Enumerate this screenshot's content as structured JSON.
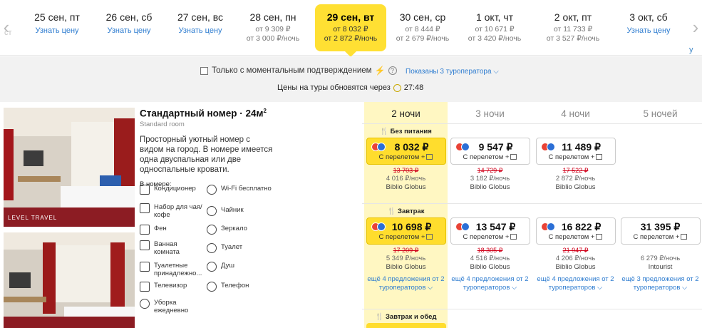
{
  "nav": {
    "prev_ghost": "ст\nу",
    "next_ghost": "у"
  },
  "dates": [
    {
      "day": "25 сен, пт",
      "link": "Узнать цену"
    },
    {
      "day": "26 сен, сб",
      "link": "Узнать цену"
    },
    {
      "day": "27 сен, вс",
      "link": "Узнать цену"
    },
    {
      "day": "28 сен, пн",
      "price_total": "от 9 309 ₽",
      "price_night": "от 3 000 ₽/ночь"
    },
    {
      "day": "29 сен, вт",
      "price_total": "от 8 032 ₽",
      "price_night": "от 2 872 ₽/ночь",
      "selected": true
    },
    {
      "day": "30 сен, ср",
      "price_total": "от 8 444 ₽",
      "price_night": "от 2 679 ₽/ночь"
    },
    {
      "day": "1 окт, чт",
      "price_total": "от 10 671 ₽",
      "price_night": "от 3 420 ₽/ночь"
    },
    {
      "day": "2 окт, пт",
      "price_total": "от 11 733 ₽",
      "price_night": "от 3 527 ₽/ночь"
    },
    {
      "day": "3 окт, сб",
      "link": "Узнать цену"
    }
  ],
  "filters": {
    "instant_label": "Только с моментальным подтверждением",
    "operators_label": "Показаны 3 туроператора",
    "update_label": "Цены на туры обновятся через",
    "update_timer": "27:48"
  },
  "room": {
    "title": "Стандартный номер · 24м",
    "title_sup": "2",
    "subtitle": "Standard room",
    "description": "Просторный уютный номер с видом на город. В номере имеется одна двуспальная или две односпальные кровати.",
    "amenities_heading": "В номере:",
    "watermark": "LEVEL TRAVEL",
    "amenities": [
      {
        "icon": "air-conditioner-icon",
        "label": "Кондиционер"
      },
      {
        "icon": "wifi-icon",
        "label": "Wi-Fi бесплатно"
      },
      {
        "icon": "tea-set-icon",
        "label": "Набор для чая/ кофе"
      },
      {
        "icon": "kettle-icon",
        "label": "Чайник"
      },
      {
        "icon": "hairdryer-icon",
        "label": "Фен"
      },
      {
        "icon": "mirror-icon",
        "label": "Зеркало"
      },
      {
        "icon": "bathtub-icon",
        "label": "Ванная комната"
      },
      {
        "icon": "toilet-icon",
        "label": "Туалет"
      },
      {
        "icon": "toiletries-icon",
        "label": "Туалетные принадлежно..."
      },
      {
        "icon": "shower-icon",
        "label": "Душ"
      },
      {
        "icon": "tv-icon",
        "label": "Телевизор"
      },
      {
        "icon": "phone-icon",
        "label": "Телефон"
      },
      {
        "icon": "cleaning-icon",
        "label": "Уборка ежедневно"
      }
    ]
  },
  "nights": [
    "2 ночи",
    "3 ночи",
    "4 ночи",
    "5 ночей"
  ],
  "meal_sections": [
    {
      "label": "Без питания",
      "offers": [
        {
          "price": "8 032 ₽",
          "flight": "С перелетом +",
          "old": "13 703 ₽",
          "per_night": "4 016 ₽/ночь",
          "operator": "Biblio Globus",
          "style": "yellow",
          "icons": true
        },
        {
          "price": "9 547 ₽",
          "flight": "С перелетом +",
          "old": "14 729 ₽",
          "per_night": "3 182 ₽/ночь",
          "operator": "Biblio Globus",
          "style": "white",
          "icons": true
        },
        {
          "price": "11 489 ₽",
          "flight": "С перелетом +",
          "old": "17 522 ₽",
          "per_night": "2 872 ₽/ночь",
          "operator": "Biblio Globus",
          "style": "white",
          "icons": true
        }
      ]
    },
    {
      "label": "Завтрак",
      "offers": [
        {
          "price": "10 698 ₽",
          "flight": "С перелетом +",
          "old": "17 209 ₽",
          "per_night": "5 349 ₽/ночь",
          "operator": "Biblio Globus",
          "more": "ещё 4 предложения от 2 туроператоров",
          "style": "yellow",
          "icons": true
        },
        {
          "price": "13 547 ₽",
          "flight": "С перелетом +",
          "old": "18 305 ₽",
          "per_night": "4 516 ₽/ночь",
          "operator": "Biblio Globus",
          "more": "ещё 4 предложения от 2 туроператоров",
          "style": "white",
          "icons": true
        },
        {
          "price": "16 822 ₽",
          "flight": "С перелетом +",
          "old": "21 947 ₽",
          "per_night": "4 206 ₽/ночь",
          "operator": "Biblio Globus",
          "more": "ещё 4 предложения от 2 туроператоров",
          "style": "white",
          "icons": true
        },
        {
          "price": "31 395 ₽",
          "flight": "С перелетом +",
          "old": "",
          "per_night": "6 279 ₽/ночь",
          "operator": "Intourist",
          "more": "ещё 3 предложения от 2 туроператоров",
          "style": "white",
          "icons": false
        }
      ]
    },
    {
      "label": "Завтрак и обед",
      "offers": []
    }
  ],
  "colors": {
    "accent": "#ffdd2d",
    "link": "#2f7dd0",
    "old_price": "#d0021b",
    "highlight_col": "#fff7c2"
  }
}
